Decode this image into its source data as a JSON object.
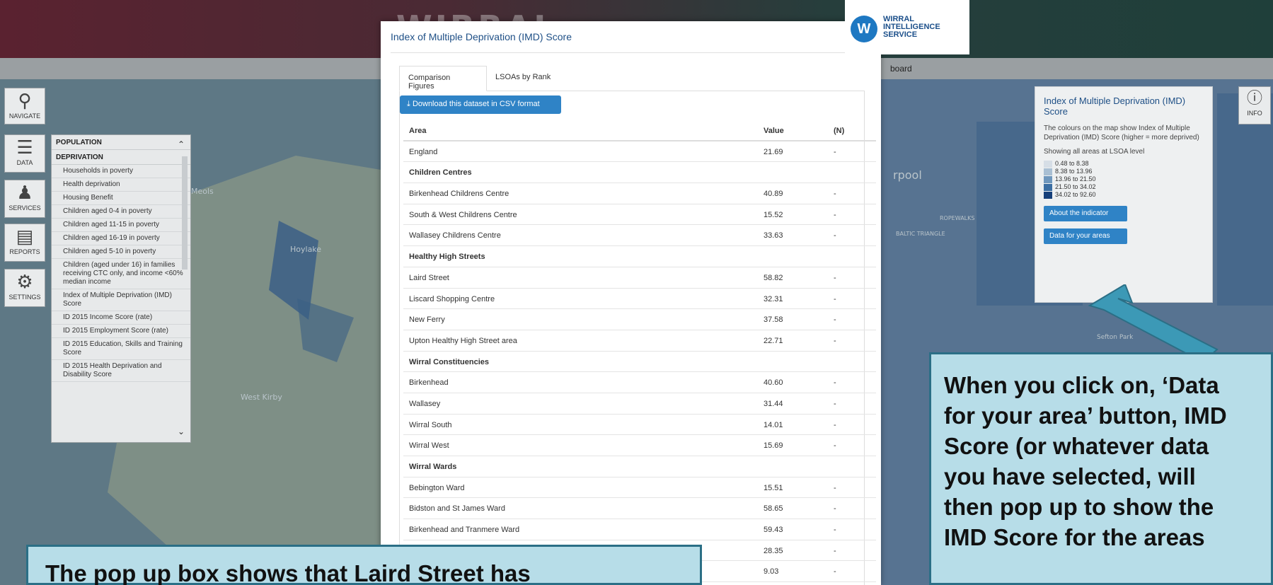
{
  "header": {
    "logo_text": "WIRRAL",
    "subnav_text": "board"
  },
  "left_toolbar": [
    {
      "label": "NAVIGATE",
      "icon": "magnifier-icon"
    },
    {
      "label": "DATA",
      "icon": "layers-icon"
    },
    {
      "label": "SERVICES",
      "icon": "people-icon"
    },
    {
      "label": "REPORTS",
      "icon": "report-icon"
    },
    {
      "label": "SETTINGS",
      "icon": "gear-icon"
    }
  ],
  "layer_menu": {
    "section1": "POPULATION",
    "section2": "DEPRIVATION",
    "items": [
      "Households in poverty",
      "Health deprivation",
      "Housing Benefit",
      "Children aged 0-4 in poverty",
      "Children aged 11-15 in poverty",
      "Children aged 16-19 in poverty",
      "Children aged 5-10 in poverty",
      "Children (aged under 16) in families receiving CTC only, and income <60% median income",
      "Index of Multiple Deprivation (IMD) Score",
      "ID 2015 Income Score (rate)",
      "ID 2015 Employment Score (rate)",
      "ID 2015 Education, Skills and Training Score",
      "ID 2015 Health Deprivation and Disability Score"
    ]
  },
  "popup": {
    "title": "Index of Multiple Deprivation (IMD) Score",
    "tabs": [
      "Comparison Figures",
      "LSOAs by Rank"
    ],
    "csv_button": "Download this dataset in CSV format",
    "columns": [
      "Area",
      "Value",
      "(N)"
    ],
    "rows": [
      {
        "area": "England",
        "value": "21.69",
        "n": "-"
      },
      {
        "group": "Children Centres"
      },
      {
        "area": "Birkenhead Childrens Centre",
        "value": "40.89",
        "n": "-"
      },
      {
        "area": "South & West Childrens Centre",
        "value": "15.52",
        "n": "-"
      },
      {
        "area": "Wallasey Childrens Centre",
        "value": "33.63",
        "n": "-"
      },
      {
        "group": "Healthy High Streets"
      },
      {
        "area": "Laird Street",
        "value": "58.82",
        "n": "-"
      },
      {
        "area": "Liscard Shopping Centre",
        "value": "32.31",
        "n": "-"
      },
      {
        "area": "New Ferry",
        "value": "37.58",
        "n": "-"
      },
      {
        "area": "Upton Healthy High Street area",
        "value": "22.71",
        "n": "-"
      },
      {
        "group": "Wirral Constituencies"
      },
      {
        "area": "Birkenhead",
        "value": "40.60",
        "n": "-"
      },
      {
        "area": "Wallasey",
        "value": "31.44",
        "n": "-"
      },
      {
        "area": "Wirral South",
        "value": "14.01",
        "n": "-"
      },
      {
        "area": "Wirral West",
        "value": "15.69",
        "n": "-"
      },
      {
        "group": "Wirral Wards"
      },
      {
        "area": "Bebington Ward",
        "value": "15.51",
        "n": "-"
      },
      {
        "area": "Bidston and St James Ward",
        "value": "58.65",
        "n": "-"
      },
      {
        "area": "Birkenhead and Tranmere Ward",
        "value": "59.43",
        "n": "-"
      },
      {
        "area": "",
        "value": "28.35",
        "n": "-"
      },
      {
        "area": "",
        "value": "9.03",
        "n": "-"
      }
    ]
  },
  "wis_logo": {
    "mark": "W",
    "line1": "WIRRAL",
    "line2": "INTELLIGENCE",
    "line3": "SERVICE"
  },
  "info_panel": {
    "title": "Index of Multiple Deprivation (IMD) Score",
    "description": "The colours on the map show Index of Multiple Deprivation (IMD) Score (higher = more deprived)",
    "showing": "Showing all areas at LSOA level",
    "legend": [
      {
        "label": "0.48 to 8.38",
        "color": "#d6dee6"
      },
      {
        "label": "8.38 to 13.96",
        "color": "#a9bfd3"
      },
      {
        "label": "13.96 to 21.50",
        "color": "#6f97bd"
      },
      {
        "label": "21.50 to 34.02",
        "color": "#3b6ea3"
      },
      {
        "label": "34.02 to 92.60",
        "color": "#163f7a"
      }
    ],
    "about_button": "About the indicator",
    "data_button": "Data for your areas",
    "info_label": "INFO"
  },
  "map_labels": [
    "Meols",
    "Hoylake",
    "West Kirby",
    "rpool",
    "ROPEWALKS",
    "BALTIC TRIANGLE",
    "Sefton Park"
  ],
  "callouts": {
    "right_lines": [
      "When you click on, ‘Data",
      "for your area’ button, IMD",
      "Score (or whatever data",
      "you have selected, will",
      "then pop up to show the",
      "IMD Score for the areas"
    ],
    "left_text": "The pop up box shows that Laird Street has"
  }
}
